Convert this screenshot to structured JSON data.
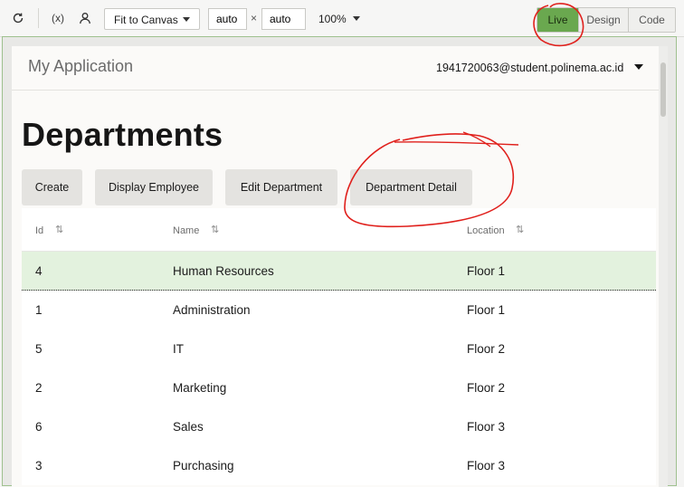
{
  "toolbar": {
    "refresh_icon": "refresh-icon",
    "variables_icon": "variables-icon",
    "variables_label": "(x)",
    "user_icon": "user-icon",
    "fit_select": "Fit to Canvas",
    "width": "auto",
    "height": "auto",
    "times": "×",
    "zoom": "100%",
    "modes": {
      "live": "Live",
      "design": "Design",
      "code": "Code"
    },
    "active_mode": "Live",
    "accent": "#6aa84f"
  },
  "app": {
    "title": "My Application",
    "user_email": "1941720063@student.polinema.ac.id",
    "page_title": "Departments",
    "buttons": {
      "create": "Create",
      "display_employee": "Display Employee",
      "edit_department": "Edit Department",
      "department_detail": "Department Detail"
    },
    "table": {
      "columns": [
        "Id",
        "Name",
        "Location"
      ],
      "rows": [
        {
          "id": "4",
          "name": "Human Resources",
          "location": "Floor 1",
          "selected": true
        },
        {
          "id": "1",
          "name": "Administration",
          "location": "Floor 1"
        },
        {
          "id": "5",
          "name": "IT",
          "location": "Floor 2"
        },
        {
          "id": "2",
          "name": "Marketing",
          "location": "Floor 2"
        },
        {
          "id": "6",
          "name": "Sales",
          "location": "Floor 3"
        },
        {
          "id": "3",
          "name": "Purchasing",
          "location": "Floor 3"
        }
      ],
      "selected_row_color": "#e3f2de"
    }
  },
  "annotation_color": "#e0201c"
}
